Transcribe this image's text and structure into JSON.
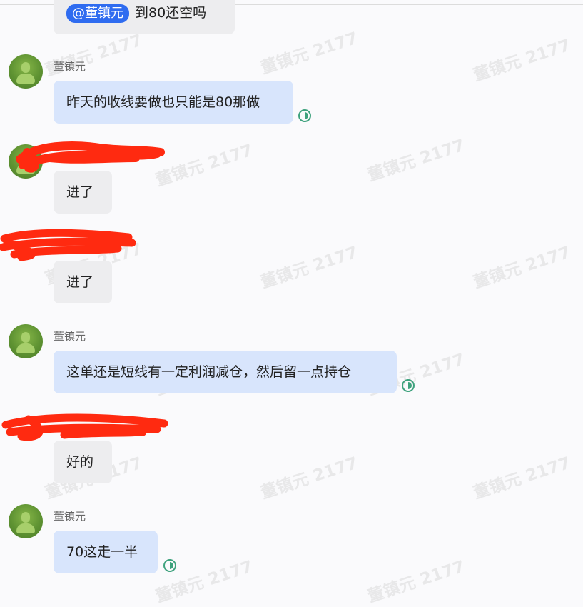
{
  "watermark": "董镇元 2177",
  "messages": [
    {
      "sender": "",
      "mention": "@董镇元",
      "text": "到80还空吗"
    },
    {
      "sender": "董镇元",
      "text": "昨天的收线要做也只能是80那做"
    },
    {
      "sender": "[redacted]",
      "text": "进了"
    },
    {
      "sender": "[redacted]",
      "text": "进了"
    },
    {
      "sender": "董镇元",
      "text": "这单还是短线有一定利润减仓，然后留一点持仓"
    },
    {
      "sender": "[redacted]",
      "text": "好的"
    },
    {
      "sender": "董镇元",
      "text": "70这走一半"
    }
  ],
  "colors": {
    "background": "#fafafc",
    "own_bubble": "#d8e5fc",
    "other_bubble": "#ededef",
    "mention": "#2f6cf0",
    "read_receipt": "#3ea27d",
    "redaction": "#ff2a10"
  },
  "icons": {
    "avatar": "user-avatar",
    "read": "read-receipt-icon"
  }
}
